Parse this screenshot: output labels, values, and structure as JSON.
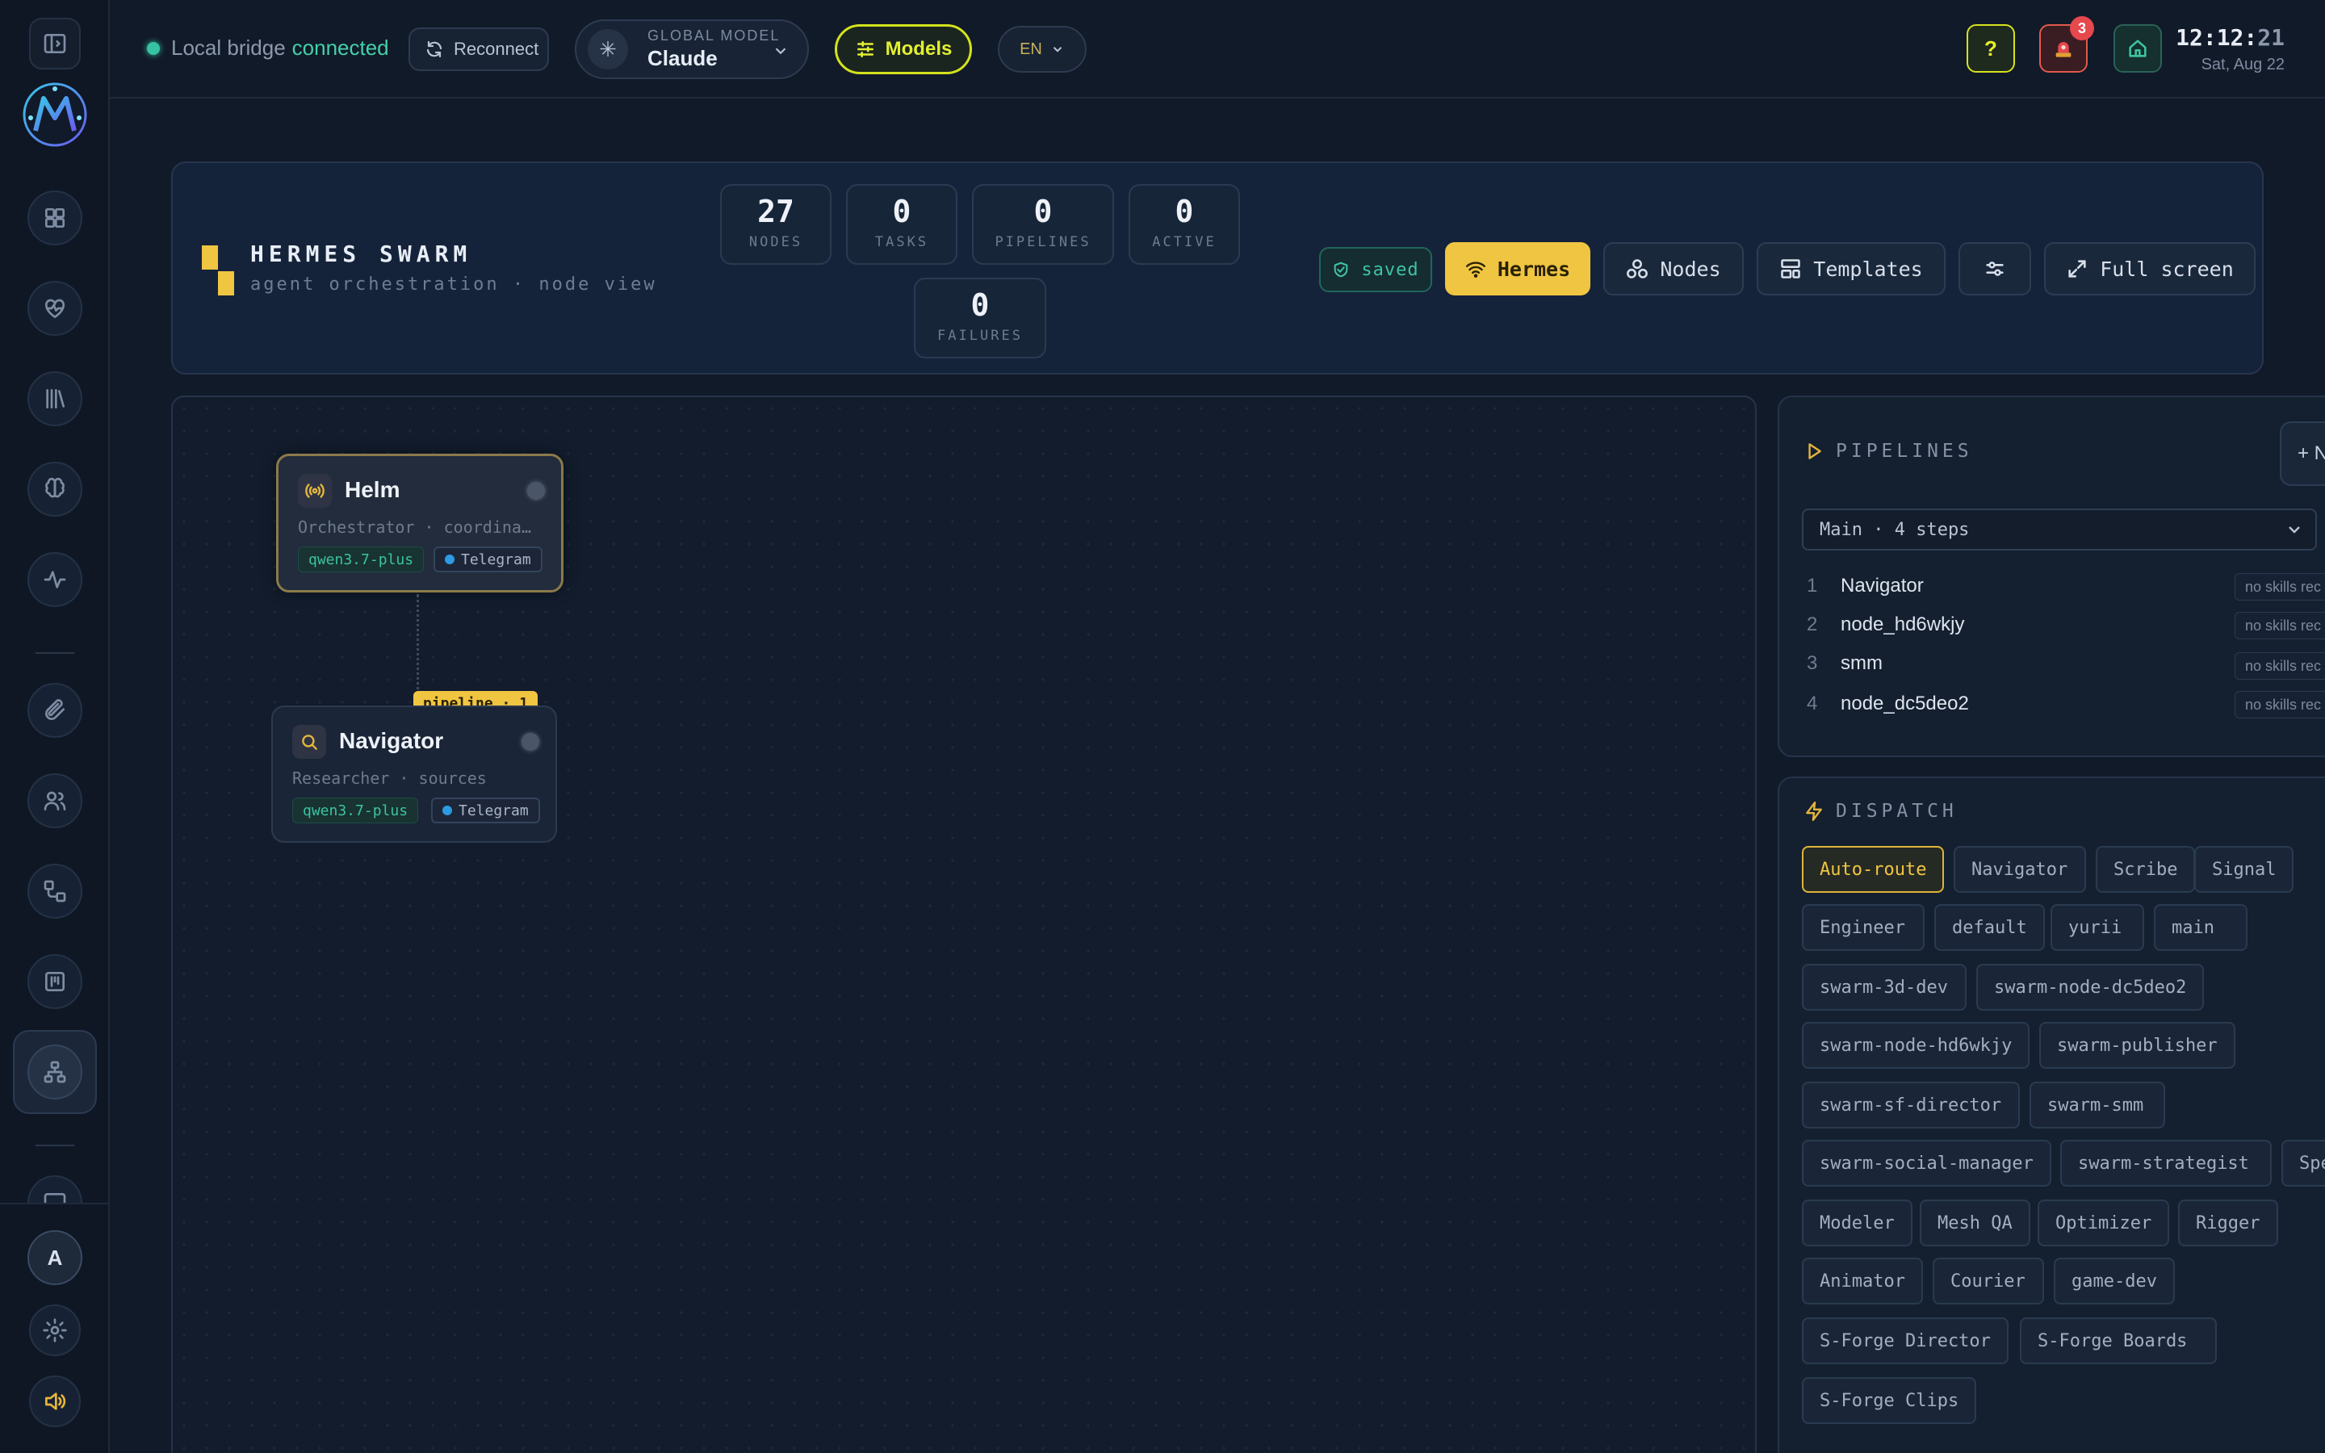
{
  "topbar": {
    "bridge_label": "Local bridge",
    "bridge_status": "connected",
    "reconnect_label": "Reconnect",
    "global_model_caption": "GLOBAL MODEL",
    "global_model_value": "Claude",
    "models_label": "Models",
    "language": "EN",
    "help_label": "?",
    "alert_count": "3",
    "time_hm": "12:12:",
    "time_s": "21",
    "date": "Sat, Aug 22"
  },
  "sidebar": {
    "avatar_initial": "A"
  },
  "header": {
    "title": "HERMES SWARM",
    "subtitle": "agent orchestration · node view",
    "stats": [
      {
        "value": "27",
        "label": "NODES"
      },
      {
        "value": "0",
        "label": "TASKS"
      },
      {
        "value": "0",
        "label": "PIPELINES"
      },
      {
        "value": "0",
        "label": "ACTIVE"
      },
      {
        "value": "0",
        "label": "FAILURES"
      }
    ],
    "saved_label": "saved",
    "buttons": {
      "hermes": "Hermes",
      "nodes": "Nodes",
      "templates": "Templates",
      "fullscreen": "Full screen"
    }
  },
  "canvas": {
    "nodes": [
      {
        "name": "Helm",
        "role": "Orchestrator · coordina…",
        "model": "qwen3.7-plus",
        "channel": "Telegram"
      },
      {
        "name": "Navigator",
        "role": "Researcher · sources",
        "model": "qwen3.7-plus",
        "channel": "Telegram",
        "badge": "pipeline · 1"
      }
    ]
  },
  "pipelines": {
    "title": "PIPELINES",
    "add_label": "+ N",
    "selected": "Main · 4 steps",
    "steps": [
      {
        "index": "1",
        "name": "Navigator",
        "note": "no skills rec"
      },
      {
        "index": "2",
        "name": "node_hd6wkjy",
        "note": "no skills rec"
      },
      {
        "index": "3",
        "name": "smm",
        "note": "no skills rec"
      },
      {
        "index": "4",
        "name": "node_dc5deo2",
        "note": "no skills rec"
      }
    ]
  },
  "dispatch": {
    "title": "DISPATCH",
    "targets": [
      "Auto-route",
      "Navigator",
      "Scribe",
      "Signal",
      "Engineer",
      "default",
      "yurii",
      "main",
      "swarm-3d-dev",
      "swarm-node-dc5deo2",
      "swarm-node-hd6wkjy",
      "swarm-publisher",
      "swarm-sf-director",
      "swarm-smm",
      "swarm-social-manager",
      "swarm-strategist",
      "Spe",
      "Modeler",
      "Mesh QA",
      "Optimizer",
      "Rigger",
      "Animator",
      "Courier",
      "game-dev",
      "S-Forge Director",
      "S-Forge Boards",
      "S-Forge Clips"
    ],
    "selected": "Auto-route"
  }
}
